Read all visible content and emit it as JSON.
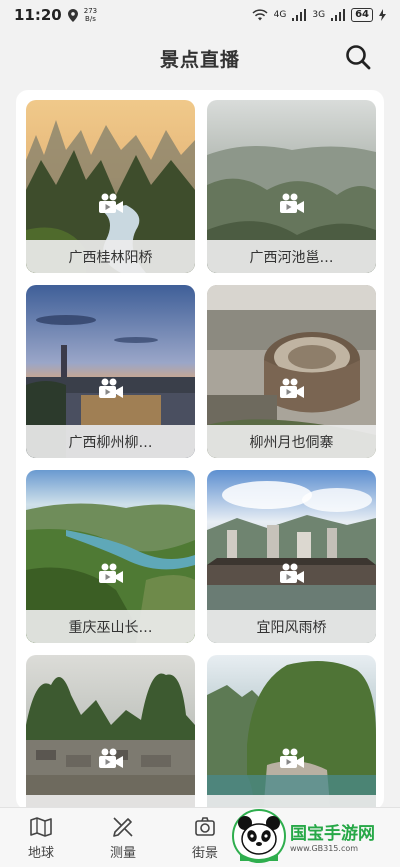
{
  "status": {
    "time": "11:20",
    "speed_value": "273",
    "speed_unit": "B/s",
    "net_a": "4G",
    "net_b": "3G",
    "battery": "64"
  },
  "header": {
    "title": "景点直播",
    "search_icon": "search-icon"
  },
  "cards": [
    {
      "label": "广西桂林阳桥",
      "icon": "video-camera-icon"
    },
    {
      "label": "广西河池邕…",
      "icon": "video-camera-icon"
    },
    {
      "label": "广西柳州柳…",
      "icon": "video-camera-icon"
    },
    {
      "label": "柳州月也侗寨",
      "icon": "video-camera-icon"
    },
    {
      "label": "重庆巫山长…",
      "icon": "video-camera-icon"
    },
    {
      "label": "宜阳风雨桥",
      "icon": "video-camera-icon"
    },
    {
      "label": "",
      "icon": "video-camera-icon"
    },
    {
      "label": "",
      "icon": "video-camera-icon"
    }
  ],
  "tabbar": {
    "items": [
      {
        "label": "地球",
        "icon": "map-icon"
      },
      {
        "label": "测量",
        "icon": "ruler-pencil-icon"
      },
      {
        "label": "街景",
        "icon": "camera-icon"
      }
    ]
  },
  "watermark": {
    "main": "国宝手游网",
    "url": "www.GB315.com"
  },
  "colors": {
    "watermark_green": "#27a847",
    "card_label_bg": "#ebebeb"
  }
}
